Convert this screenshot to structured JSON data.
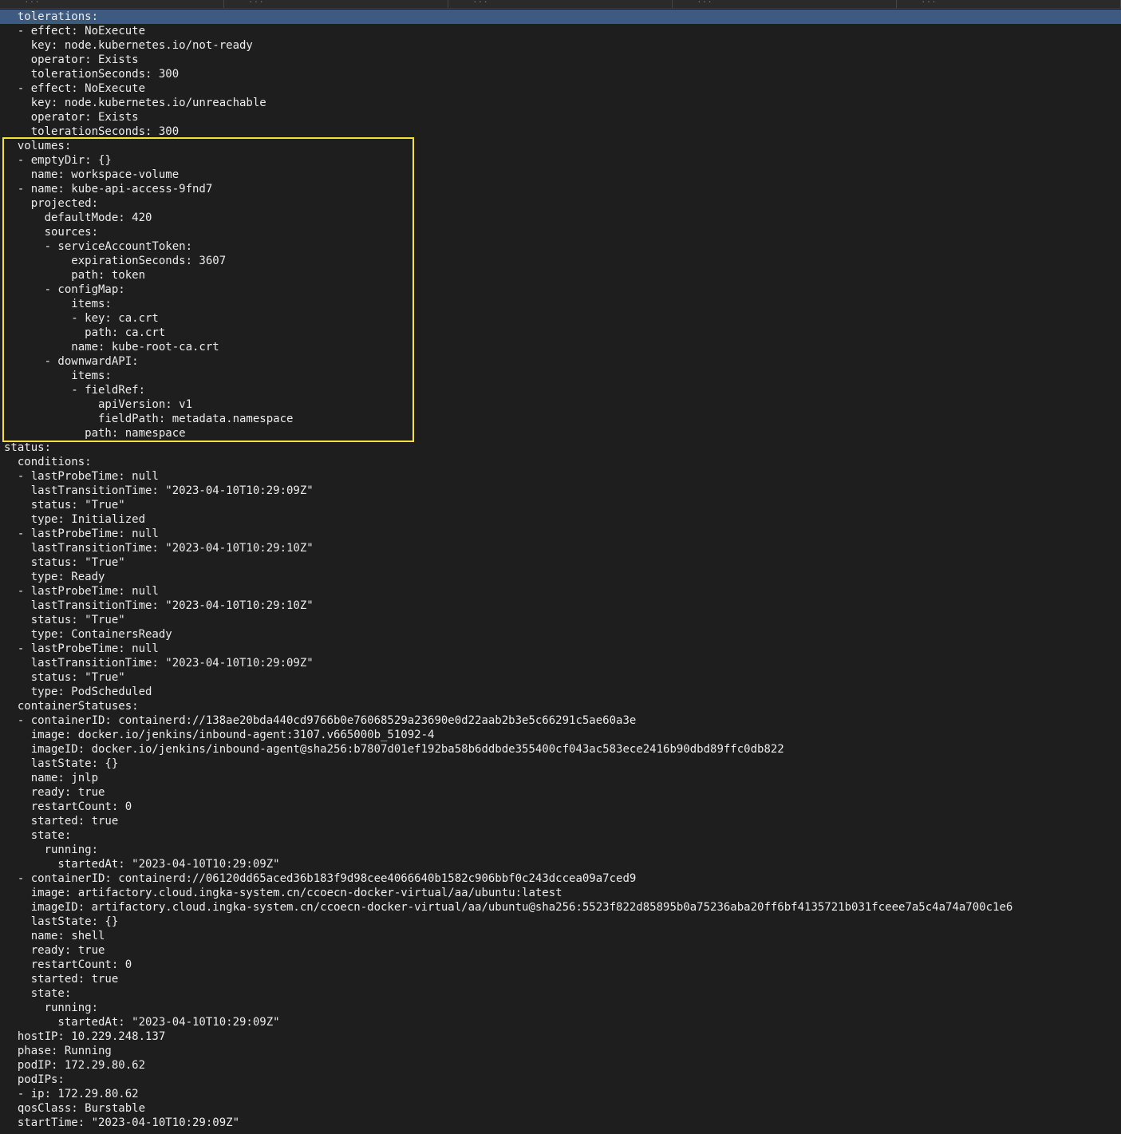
{
  "tabs": [
    {
      "title": "...",
      "icon": "ellipsis-icon",
      "glyph": "•••"
    },
    {
      "title": "...",
      "icon": "ellipsis-icon",
      "glyph": "•••"
    },
    {
      "title": "...",
      "icon": "ellipsis-icon",
      "glyph": "•••"
    },
    {
      "title": "...",
      "icon": "ellipsis-icon",
      "glyph": "•••"
    },
    {
      "title": "...",
      "icon": "ellipsis-icon",
      "glyph": "•••"
    }
  ],
  "colors": {
    "background": "#1e1e1e",
    "text": "#ececec",
    "selection": "#3d5a80",
    "highlight_box": "#f4e03f"
  },
  "selected_line": 0,
  "highlight_box": {
    "first_line": 9,
    "last_line": 29
  },
  "lines": [
    "  tolerations:",
    "  - effect: NoExecute",
    "    key: node.kubernetes.io/not-ready",
    "    operator: Exists",
    "    tolerationSeconds: 300",
    "  - effect: NoExecute",
    "    key: node.kubernetes.io/unreachable",
    "    operator: Exists",
    "    tolerationSeconds: 300",
    "  volumes:",
    "  - emptyDir: {}",
    "    name: workspace-volume",
    "  - name: kube-api-access-9fnd7",
    "    projected:",
    "      defaultMode: 420",
    "      sources:",
    "      - serviceAccountToken:",
    "          expirationSeconds: 3607",
    "          path: token",
    "      - configMap:",
    "          items:",
    "          - key: ca.crt",
    "            path: ca.crt",
    "          name: kube-root-ca.crt",
    "      - downwardAPI:",
    "          items:",
    "          - fieldRef:",
    "              apiVersion: v1",
    "              fieldPath: metadata.namespace",
    "            path: namespace",
    "status:",
    "  conditions:",
    "  - lastProbeTime: null",
    "    lastTransitionTime: \"2023-04-10T10:29:09Z\"",
    "    status: \"True\"",
    "    type: Initialized",
    "  - lastProbeTime: null",
    "    lastTransitionTime: \"2023-04-10T10:29:10Z\"",
    "    status: \"True\"",
    "    type: Ready",
    "  - lastProbeTime: null",
    "    lastTransitionTime: \"2023-04-10T10:29:10Z\"",
    "    status: \"True\"",
    "    type: ContainersReady",
    "  - lastProbeTime: null",
    "    lastTransitionTime: \"2023-04-10T10:29:09Z\"",
    "    status: \"True\"",
    "    type: PodScheduled",
    "  containerStatuses:",
    "  - containerID: containerd://138ae20bda440cd9766b0e76068529a23690e0d22aab2b3e5c66291c5ae60a3e",
    "    image: docker.io/jenkins/inbound-agent:3107.v665000b_51092-4",
    "    imageID: docker.io/jenkins/inbound-agent@sha256:b7807d01ef192ba58b6ddbde355400cf043ac583ece2416b90dbd89ffc0db822",
    "    lastState: {}",
    "    name: jnlp",
    "    ready: true",
    "    restartCount: 0",
    "    started: true",
    "    state:",
    "      running:",
    "        startedAt: \"2023-04-10T10:29:09Z\"",
    "  - containerID: containerd://06120dd65aced36b183f9d98cee4066640b1582c906bbf0c243dccea09a7ced9",
    "    image: artifactory.cloud.ingka-system.cn/ccoecn-docker-virtual/aa/ubuntu:latest",
    "    imageID: artifactory.cloud.ingka-system.cn/ccoecn-docker-virtual/aa/ubuntu@sha256:5523f822d85895b0a75236aba20ff6bf4135721b031fceee7a5c4a74a700c1e6",
    "    lastState: {}",
    "    name: shell",
    "    ready: true",
    "    restartCount: 0",
    "    started: true",
    "    state:",
    "      running:",
    "        startedAt: \"2023-04-10T10:29:09Z\"",
    "  hostIP: 10.229.248.137",
    "  phase: Running",
    "  podIP: 172.29.80.62",
    "  podIPs:",
    "  - ip: 172.29.80.62",
    "  qosClass: Burstable",
    "  startTime: \"2023-04-10T10:29:09Z\""
  ]
}
